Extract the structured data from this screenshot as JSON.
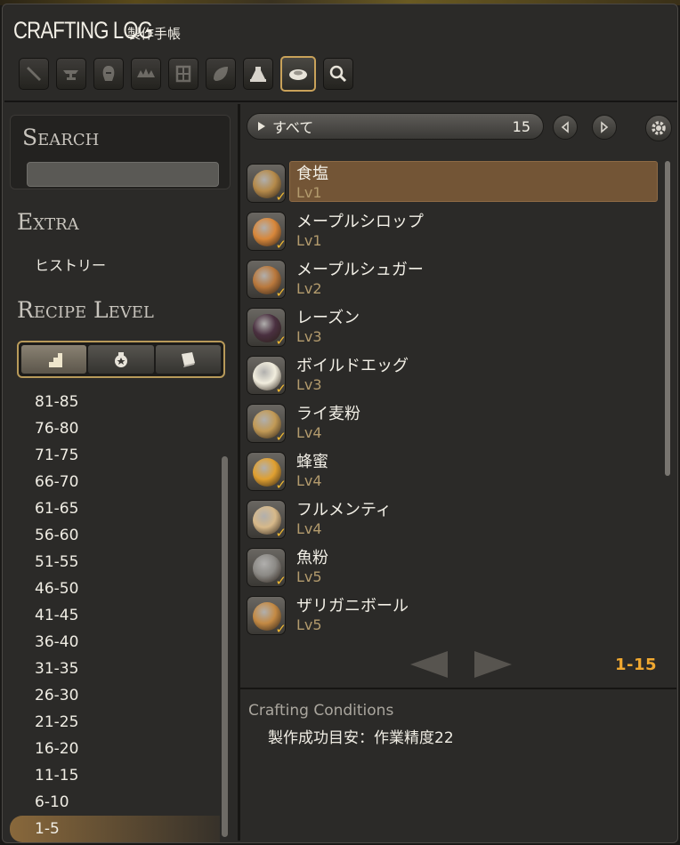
{
  "window": {
    "title": "CRAFTING LOG",
    "subtitle": "製作手帳"
  },
  "tabs": [
    {
      "icon": "carpenter-icon"
    },
    {
      "icon": "blacksmith-icon"
    },
    {
      "icon": "armorer-icon"
    },
    {
      "icon": "goldsmith-icon"
    },
    {
      "icon": "leatherworker-icon"
    },
    {
      "icon": "weaver-icon"
    },
    {
      "icon": "alchemist-icon"
    },
    {
      "icon": "culinarian-icon",
      "active": true
    },
    {
      "icon": "search-icon"
    }
  ],
  "left": {
    "search_heading": "Search",
    "search_value": "",
    "extra_heading": "Extra",
    "history_label": "ヒストリー",
    "recipe_level_heading": "Recipe Level",
    "levels": [
      "81-85",
      "76-80",
      "71-75",
      "66-70",
      "61-65",
      "56-60",
      "51-55",
      "46-50",
      "41-45",
      "36-40",
      "31-35",
      "26-30",
      "21-25",
      "16-20",
      "11-15",
      "6-10",
      "1-5"
    ],
    "selected_level": "1-5"
  },
  "filter": {
    "label": "すべて",
    "count": "15"
  },
  "recipes": [
    {
      "name": "食塩",
      "level": "Lv1",
      "color": "#b58a4a",
      "selected": true
    },
    {
      "name": "メープルシロップ",
      "level": "Lv1",
      "color": "#d8873a"
    },
    {
      "name": "メープルシュガー",
      "level": "Lv2",
      "color": "#b9783c"
    },
    {
      "name": "レーズン",
      "level": "Lv3",
      "color": "#4a3040"
    },
    {
      "name": "ボイルドエッグ",
      "level": "Lv3",
      "color": "#f2eede"
    },
    {
      "name": "ライ麦粉",
      "level": "Lv4",
      "color": "#c29a56"
    },
    {
      "name": "蜂蜜",
      "level": "Lv4",
      "color": "#e0a030"
    },
    {
      "name": "フルメンティ",
      "level": "Lv4",
      "color": "#d7b98a"
    },
    {
      "name": "魚粉",
      "level": "Lv5",
      "color": "#8c8a86"
    },
    {
      "name": "ザリガニボール",
      "level": "Lv5",
      "color": "#c48a44"
    }
  ],
  "pagination": {
    "range": "1-15"
  },
  "conditions": {
    "title": "Crafting Conditions",
    "text": "製作成功目安：作業精度22"
  }
}
